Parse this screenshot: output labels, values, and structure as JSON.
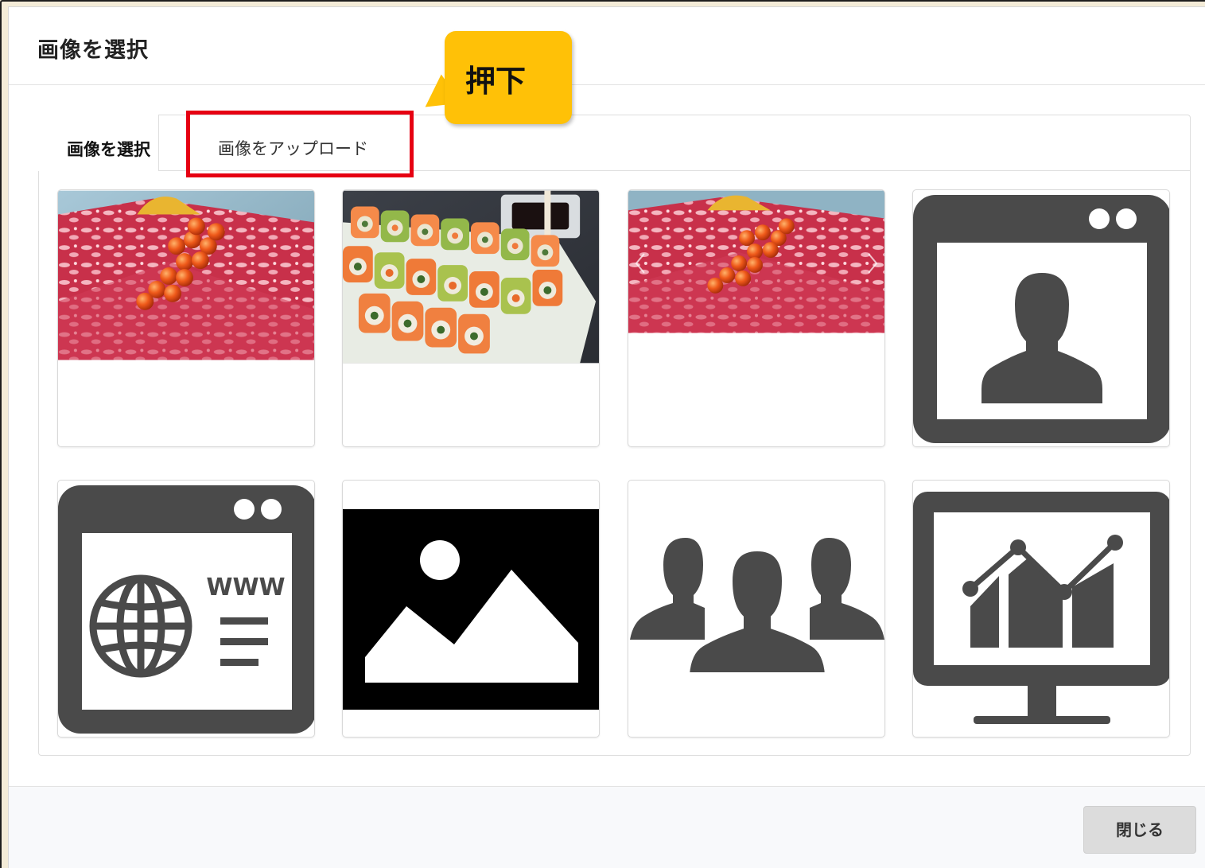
{
  "dialog": {
    "title": "画像を選択",
    "tabs": [
      {
        "label": "画像を選択",
        "active": true
      },
      {
        "label": "画像をアップロード",
        "active": false
      }
    ],
    "callout_text": "押下",
    "close_label": "閉じる"
  },
  "gallery": {
    "items": [
      {
        "icon": "wagyu-ikura-photo"
      },
      {
        "icon": "sushi-rolls-photo"
      },
      {
        "icon": "wagyu-ikura-photo"
      },
      {
        "icon": "person-profile-icon"
      },
      {
        "icon": "website-www-icon",
        "text": "WWW"
      },
      {
        "icon": "landscape-image-icon"
      },
      {
        "icon": "group-people-icon"
      },
      {
        "icon": "monitor-chart-icon"
      }
    ]
  },
  "colors": {
    "highlight": "#e60012",
    "callout": "#ffc107",
    "icon_gray": "#4a4a4a"
  }
}
